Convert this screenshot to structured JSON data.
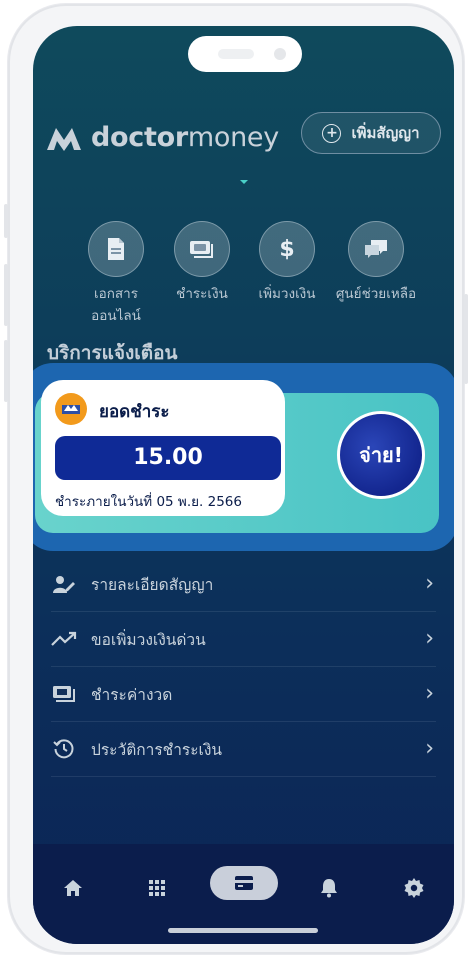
{
  "app": {
    "brand": {
      "bold": "doctor",
      "light": "money"
    },
    "add_contract_label": "เพิ่มสัญญา"
  },
  "quick_actions": [
    {
      "label_line1": "เอกสาร",
      "label_line2": "ออนไลน์",
      "icon": "document-icon"
    },
    {
      "label_line1": "ชำระเงิน",
      "label_line2": "",
      "icon": "payment-icon"
    },
    {
      "label_line1": "เพิ่มวงเงิน",
      "label_line2": "",
      "icon": "dollar-icon"
    },
    {
      "label_line1": "ศูนย์ช่วยเหลือ",
      "label_line2": "",
      "icon": "chat-icon"
    }
  ],
  "notifications": {
    "title": "บริการแจ้งเตือน",
    "bill": {
      "title": "ยอดชำระ",
      "amount": "15.00",
      "due": "ชำระภายในวันที่ 05 พ.ย. 2566",
      "pay_label": "จ่าย!"
    }
  },
  "menu": [
    {
      "label": "รายละเอียดสัญญา",
      "icon": "contract-edit-icon"
    },
    {
      "label": "ขอเพิ่มวงเงินด่วน",
      "icon": "trending-up-icon"
    },
    {
      "label": "ชำระค่างวด",
      "icon": "cash-icon"
    },
    {
      "label": "ประวัติการชำระเงิน",
      "icon": "history-icon"
    }
  ],
  "tabs": [
    {
      "name": "home",
      "icon": "home-icon"
    },
    {
      "name": "apps",
      "icon": "grid-icon"
    },
    {
      "name": "wallet",
      "icon": "card-icon",
      "active": true
    },
    {
      "name": "notifications",
      "icon": "bell-icon"
    },
    {
      "name": "settings",
      "icon": "gear-icon"
    }
  ],
  "colors": {
    "accent": "#0f2a96",
    "teal": "#49c3c5",
    "card_frame": "#1d66b0",
    "logo_orange": "#f29a1c"
  }
}
